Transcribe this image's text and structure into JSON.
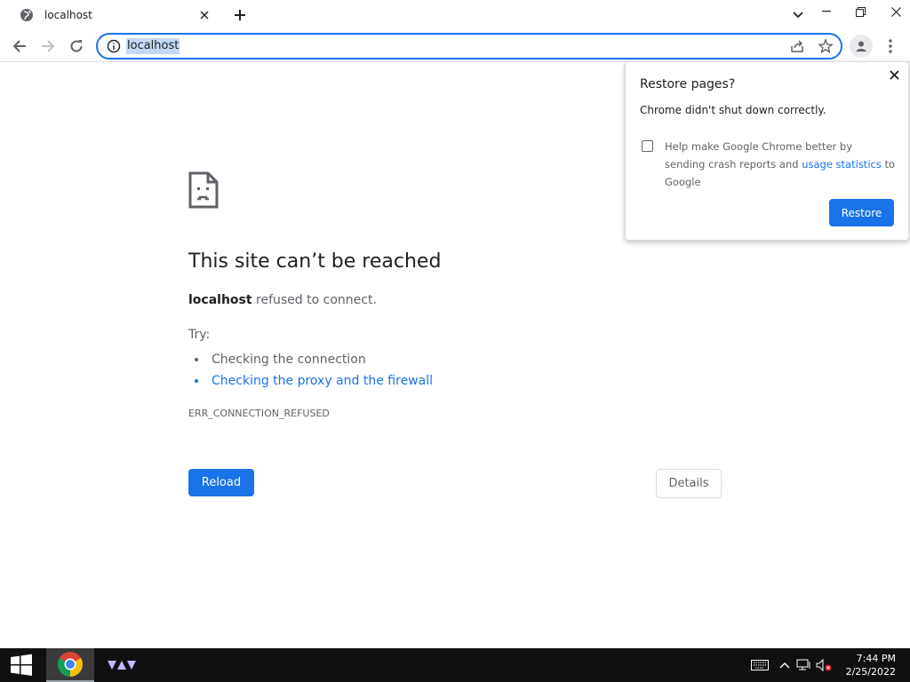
{
  "browser": {
    "tab": {
      "title": "localhost",
      "favicon": "globe-icon"
    },
    "omnibox": {
      "url": "localhost"
    }
  },
  "error_page": {
    "title": "This site can’t be reached",
    "host": "localhost",
    "message_suffix": " refused to connect.",
    "try_label": "Try:",
    "suggestions": [
      {
        "text": "Checking the connection"
      },
      {
        "text": "Checking the proxy and the firewall"
      }
    ],
    "error_code": "ERR_CONNECTION_REFUSED",
    "reload_label": "Reload",
    "details_label": "Details"
  },
  "restore_bubble": {
    "title": "Restore pages?",
    "subtitle": "Chrome didn't shut down correctly.",
    "checkbox_text_before": "Help make Google Chrome better by sending crash reports and ",
    "checkbox_link": "usage statistics",
    "checkbox_text_after": " to Google",
    "restore_label": "Restore"
  },
  "taskbar": {
    "time": "7:44 PM",
    "date": "2/25/2022"
  },
  "colors": {
    "accent": "#1a73e8",
    "taskbar": "#101010"
  }
}
